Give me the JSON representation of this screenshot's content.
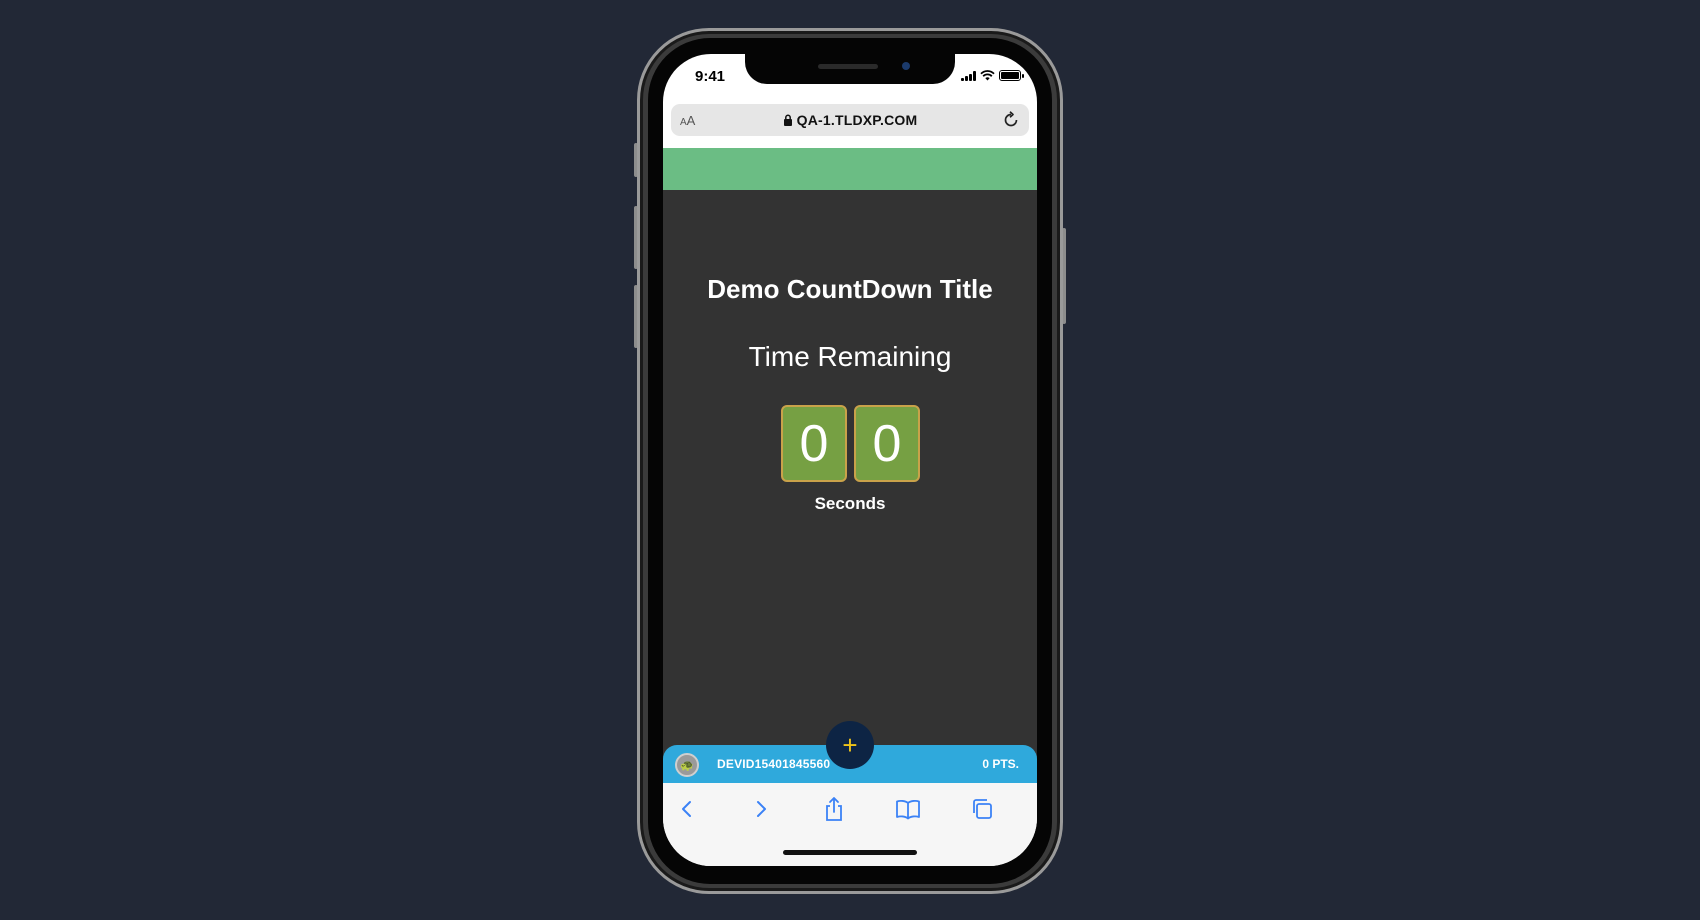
{
  "status": {
    "time": "9:41"
  },
  "browser": {
    "aa_label_small": "A",
    "aa_label_large": "A",
    "url": "QA-1.TLDXP.COM"
  },
  "countdown": {
    "title": "Demo CountDown Title",
    "subtitle": "Time Remaining",
    "digits": [
      "0",
      "0"
    ],
    "unit_label": "Seconds"
  },
  "user_bar": {
    "username": "DEVID15401845560",
    "points": "0 PTS.",
    "fab_label": "+"
  },
  "toolbar": {
    "icons": [
      "back-icon",
      "forward-icon",
      "share-icon",
      "bookmarks-icon",
      "tabs-icon"
    ]
  },
  "colors": {
    "background": "#222836",
    "green_bar": "#6bbd84",
    "content_bg": "#333333",
    "digit_bg": "#76a043",
    "digit_border": "#c9a24a",
    "user_bar": "#2fa9dc",
    "fab": "#0d2444",
    "fab_plus": "#f0c419",
    "toolbar_icon": "#3b82f6"
  }
}
